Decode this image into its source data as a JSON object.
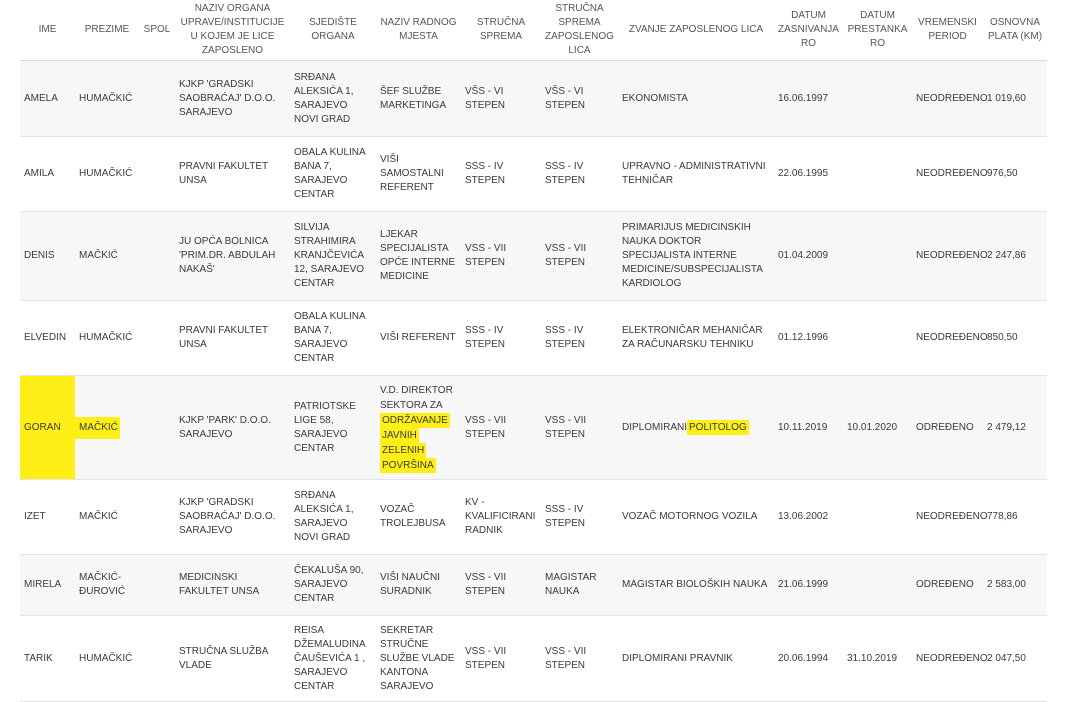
{
  "headers": [
    "IME",
    "PREZIME",
    "SPOL",
    "NAZIV ORGANA UPRAVE/INSTITUCIJE U KOJEM JE LICE ZAPOSLENO",
    "SJEDIŠTE ORGANA",
    "NAZIV RADNOG MJESTA",
    "STRUČNA SPREMA",
    "STRUČNA SPREMA ZAPOSLENOG LICA",
    "ZVANJE ZAPOSLENOG LICA",
    "DATUM ZASNIVANJA RO",
    "DATUM PRESTANKA RO",
    "VREMENSKI PERIOD",
    "OSNOVNA PLATA (KM)"
  ],
  "rows": [
    {
      "ime": "AMELA",
      "prezime": "HUMAČKIĆ",
      "spol": "",
      "organ": "KJKP 'GRADSKI SAOBRAĆAJ' D.O.O. SARAJEVO",
      "sjediste": "SRĐANA ALEKSIĆA 1, SARAJEVO NOVI GRAD",
      "radno_mjesto": "ŠEF SLUŽBE MARKETINGA",
      "strucna_sprema": "VŠS - VI STEPEN",
      "sprema_lica": "VŠS - VI STEPEN",
      "zvanje": "EKONOMISTA",
      "datum_zasnivanja": "16.06.1997",
      "datum_prestanka": "",
      "period": "NEODREĐENO",
      "plata": "1 019,60"
    },
    {
      "ime": "AMILA",
      "prezime": "HUMAČKIĆ",
      "spol": "",
      "organ": "PRAVNI FAKULTET UNSA",
      "sjediste": "OBALA KULINA BANA 7, SARAJEVO CENTAR",
      "radno_mjesto": "VIŠI SAMOSTALNI REFERENT",
      "strucna_sprema": "SSS - IV STEPEN",
      "sprema_lica": "SSS - IV STEPEN",
      "zvanje": "UPRAVNO - ADMINISTRATIVNI TEHNIČAR",
      "datum_zasnivanja": "22.06.1995",
      "datum_prestanka": "",
      "period": "NEODREĐENO",
      "plata": "976,50"
    },
    {
      "ime": "DENIS",
      "prezime": "MAČKIĆ",
      "spol": "",
      "organ": "JU OPĆA BOLNICA 'PRIM.DR. ABDULAH NAKAŠ'",
      "sjediste": "SILVIJA STRAHIMIRA KRANJČEVIĆA 12, SARAJEVO CENTAR",
      "radno_mjesto": "LJEKAR SPECIJALISTA OPĆE INTERNE MEDICINE",
      "strucna_sprema": "VSS - VII STEPEN",
      "sprema_lica": "VSS - VII STEPEN",
      "zvanje": "PRIMARIJUS MEDICINSKIH NAUKA DOKTOR SPECIJALISTA INTERNE MEDICINE/SUBSPECIJALISTA KARDIOLOG",
      "datum_zasnivanja": "01.04.2009",
      "datum_prestanka": "",
      "period": "NEODREĐENO",
      "plata": "2 247,86"
    },
    {
      "ime": "ELVEDIN",
      "prezime": "HUMAČKIĆ",
      "spol": "",
      "organ": "PRAVNI FAKULTET UNSA",
      "sjediste": "OBALA KULINA BANA 7, SARAJEVO CENTAR",
      "radno_mjesto": "VIŠI REFERENT",
      "strucna_sprema": "SSS - IV STEPEN",
      "sprema_lica": "SSS - IV STEPEN",
      "zvanje": "ELEKTRONIČAR MEHANIČAR ZA RAČUNARSKU TEHNIKU",
      "datum_zasnivanja": "01.12.1996",
      "datum_prestanka": "",
      "period": "NEODREĐENO",
      "plata": "850,50"
    },
    {
      "ime": "GORAN",
      "prezime": "MAČKIĆ",
      "spol": "",
      "organ": "KJKP 'PARK' D.O.O. SARAJEVO",
      "sjediste": "PATRIOTSKE LIGE 58, SARAJEVO CENTAR",
      "radno_mjesto_plain": "V.D. DIREKTOR SEKTORA ZA",
      "radno_mjesto_hl": "ODRŽAVANJE JAVNIH ZELENIH POVRŠINA",
      "strucna_sprema": "VSS - VII STEPEN",
      "sprema_lica": "VSS - VII STEPEN",
      "zvanje_plain": "DIPLOMIRANI",
      "zvanje_hl": "POLITOLOG",
      "datum_zasnivanja": "10.11.2019",
      "datum_prestanka": "10.01.2020",
      "period": "ODREĐENO",
      "plata": "2 479,12"
    },
    {
      "ime": "IZET",
      "prezime": "MAČKIĆ",
      "spol": "",
      "organ": "KJKP 'GRADSKI SAOBRAĆAJ' D.O.O. SARAJEVO",
      "sjediste": "SRĐANA ALEKSIĆA 1, SARAJEVO NOVI GRAD",
      "radno_mjesto": "VOZAČ TROLEJBUSA",
      "strucna_sprema": "KV - KVALIFICIRANI RADNIK",
      "sprema_lica": "SSS - IV STEPEN",
      "zvanje": "VOZAČ MOTORNOG VOZILA",
      "datum_zasnivanja": "13.06.2002",
      "datum_prestanka": "",
      "period": "NEODREĐENO",
      "plata": "778,86"
    },
    {
      "ime": "MIRELA",
      "prezime": "MAČKIĆ-ĐUROVIĆ",
      "spol": "",
      "organ": "MEDICINSKI FAKULTET UNSA",
      "sjediste": "ČEKALUŠA 90, SARAJEVO CENTAR",
      "radno_mjesto": "VIŠI NAUČNI SURADNIK",
      "strucna_sprema": "VSS - VII STEPEN",
      "sprema_lica": "MAGISTAR NAUKA",
      "zvanje": "MAGISTAR BIOLOŠKIH NAUKA",
      "datum_zasnivanja": "21.06.1999",
      "datum_prestanka": "",
      "period": "ODREĐENO",
      "plata": "2 583,00"
    },
    {
      "ime": "TARIK",
      "prezime": "HUMAČKIĆ",
      "spol": "",
      "organ": "STRUČNA SLUŽBA VLADE",
      "sjediste": "REISA DŽEMALUDINA ČAUŠEVIĆA 1 , SARAJEVO CENTAR",
      "radno_mjesto": "SEKRETAR STRUČNE SLUŽBE VLADE KANTONA SARAJEVO",
      "strucna_sprema": "VSS - VII STEPEN",
      "sprema_lica": "VSS - VII STEPEN",
      "zvanje": "DIPLOMIRANI PRAVNIK",
      "datum_zasnivanja": "20.06.1994",
      "datum_prestanka": "31.10.2019",
      "period": "NEODREĐENO",
      "plata": "2 047,50"
    }
  ],
  "highlight_color": "#ffef17"
}
